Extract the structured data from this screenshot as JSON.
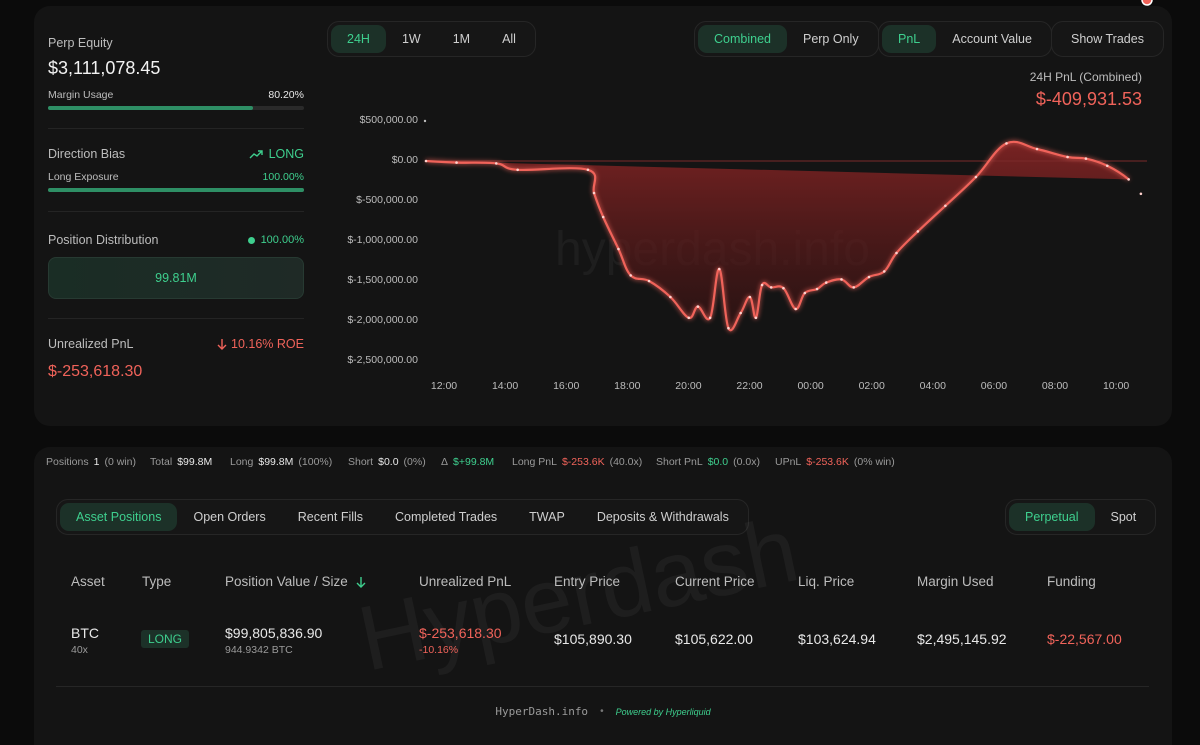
{
  "summary": {
    "perp_equity_label": "Perp Equity",
    "perp_equity_value": "$3,111,078.45",
    "margin_usage_label": "Margin Usage",
    "margin_usage_value": "80.20%",
    "margin_usage_fraction": 0.802,
    "direction_bias_label": "Direction Bias",
    "direction_bias_value": "LONG",
    "long_exposure_label": "Long Exposure",
    "long_exposure_value": "100.00%",
    "long_exposure_fraction": 1.0,
    "position_distribution_label": "Position Distribution",
    "position_distribution_value": "100.00%",
    "position_distribution_amount": "99.81M",
    "unrealized_pnl_label": "Unrealized PnL",
    "unrealized_pnl_roe": "10.16% ROE",
    "unrealized_pnl_value": "$-253,618.30"
  },
  "timeframes": [
    "24H",
    "1W",
    "1M",
    "All"
  ],
  "timeframe_active": "24H",
  "mode_tabs": [
    "Combined",
    "Perp Only"
  ],
  "mode_active": "Combined",
  "metric_tabs": [
    "PnL",
    "Account Value"
  ],
  "metric_active": "PnL",
  "show_trades_label": "Show Trades",
  "chart_header": {
    "label": "24H PnL (Combined)",
    "value": "$-409,931.53"
  },
  "watermark_chart": "hyperdash.info",
  "watermark_table": "Hyperdash",
  "chart_data": {
    "type": "area",
    "title": "24H PnL (Combined)",
    "xlabel": "",
    "ylabel": "",
    "y_ticks": [
      "$500,000.00",
      "$0.00",
      "$-500,000.00",
      "$-1,000,000.00",
      "$-1,500,000.00",
      "$-2,000,000.00",
      "$-2,500,000.00"
    ],
    "x_ticks": [
      "12:00",
      "14:00",
      "16:00",
      "18:00",
      "20:00",
      "22:00",
      "00:00",
      "02:00",
      "04:00",
      "06:00",
      "08:00",
      "10:00"
    ],
    "ylim": [
      -2500000,
      500000
    ],
    "grid": false,
    "color": "#f0635a",
    "x_hours": [
      0,
      1,
      2.3,
      3,
      5.3,
      5.5,
      5.8,
      6.3,
      6.7,
      7.3,
      8.0,
      8.6,
      8.9,
      9.3,
      9.6,
      9.9,
      10.3,
      10.6,
      10.8,
      11.0,
      11.3,
      11.7,
      12.1,
      12.4,
      12.8,
      13.1,
      13.6,
      14.0,
      14.5,
      15.0,
      15.4,
      16.1,
      17.0,
      18.0,
      19.0,
      20.0,
      21.0,
      21.6,
      22.3,
      23.0,
      23.4,
      23.6
    ],
    "y_values": [
      0,
      -20000,
      -30000,
      -110000,
      -110000,
      -400000,
      -700000,
      -1100000,
      -1430000,
      -1500000,
      -1700000,
      -1960000,
      -1820000,
      -1960000,
      -1350000,
      -2090000,
      -1900000,
      -1700000,
      -1960000,
      -1550000,
      -1580000,
      -1590000,
      -1850000,
      -1650000,
      -1600000,
      -1520000,
      -1480000,
      -1580000,
      -1450000,
      -1380000,
      -1150000,
      -880000,
      -560000,
      -200000,
      220000,
      150000,
      50000,
      30000,
      -60000,
      -230000,
      -409931.53
    ]
  },
  "stats_bar": {
    "positions_label": "Positions",
    "positions_value": "1",
    "positions_win": "(0 win)",
    "total_label": "Total",
    "total_value": "$99.8M",
    "long_label": "Long",
    "long_value": "$99.8M",
    "long_pct": "(100%)",
    "short_label": "Short",
    "short_value": "$0.0",
    "short_pct": "(0%)",
    "delta_label": "Δ",
    "delta_value": "$+99.8M",
    "long_pnl_label": "Long PnL",
    "long_pnl_value": "$-253.6K",
    "long_pnl_lev": "(40.0x)",
    "short_pnl_label": "Short PnL",
    "short_pnl_value": "$0.0",
    "short_pnl_lev": "(0.0x)",
    "upnl_label": "UPnL",
    "upnl_value": "$-253.6K",
    "upnl_win": "(0% win)"
  },
  "bottom_tabs": [
    "Asset Positions",
    "Open Orders",
    "Recent Fills",
    "Completed Trades",
    "TWAP",
    "Deposits & Withdrawals"
  ],
  "bottom_tab_active": "Asset Positions",
  "market_tabs": [
    "Perpetual",
    "Spot"
  ],
  "market_tab_active": "Perpetual",
  "table": {
    "headers": {
      "asset": "Asset",
      "type": "Type",
      "position": "Position Value / Size",
      "upnl": "Unrealized PnL",
      "entry": "Entry Price",
      "current": "Current Price",
      "liq": "Liq. Price",
      "margin": "Margin Used",
      "funding": "Funding"
    },
    "rows": [
      {
        "asset": "BTC",
        "leverage": "40x",
        "type": "LONG",
        "position_value": "$99,805,836.90",
        "position_size": "944.9342 BTC",
        "upnl": "$-253,618.30",
        "upnl_pct": "-10.16%",
        "entry": "$105,890.30",
        "current": "$105,622.00",
        "liq": "$103,624.94",
        "margin": "$2,495,145.92",
        "funding": "$-22,567.00"
      }
    ]
  },
  "footer": {
    "brand": "HyperDash.info",
    "dot": "•",
    "powered": "Powered by Hyperliquid"
  }
}
